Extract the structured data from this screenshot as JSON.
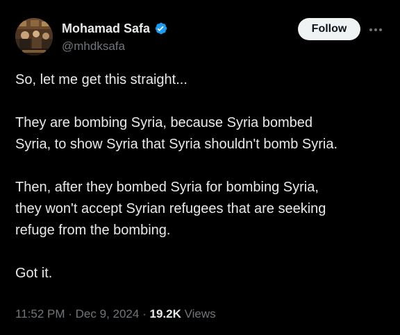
{
  "author": {
    "display_name": "Mohamad Safa",
    "handle": "@mhdksafa",
    "verified_icon": "verified-badge-icon",
    "verified_color": "#1d9bf0"
  },
  "actions": {
    "follow_label": "Follow",
    "more_icon": "more-options-icon"
  },
  "tweet": {
    "paragraphs": [
      "So, let me get this straight...",
      "They are bombing Syria, because Syria bombed\nSyria, to show Syria that Syria shouldn't bomb Syria.",
      "Then, after they bombed Syria for bombing Syria,\nthey won't accept Syrian refugees that are seeking\nrefuge from the bombing.",
      "Got it."
    ]
  },
  "meta": {
    "time": "11:52 PM",
    "separator": "·",
    "date": "Dec 9, 2024",
    "views_count": "19.2K",
    "views_label": "Views"
  },
  "colors": {
    "background": "#000000",
    "text_primary": "#e7e9ea",
    "text_secondary": "#71767b",
    "button_bg": "#eff3f4",
    "button_text": "#0f1419"
  }
}
